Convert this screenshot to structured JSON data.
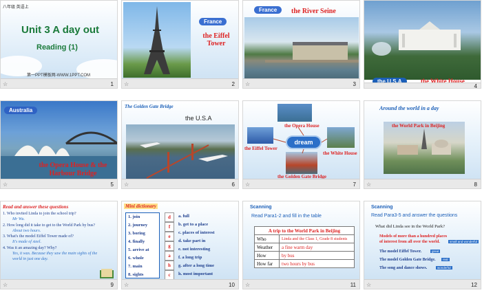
{
  "slides": [
    {
      "n": "1",
      "title": "Unit 3  A day out",
      "sub": "Reading  (1)",
      "small": "八年级 英语上",
      "wm": "第一PPT模板网-WWW.1PPT.COM"
    },
    {
      "n": "2",
      "pill": "France",
      "label": "the Eiffel Tower"
    },
    {
      "n": "3",
      "pill": "France",
      "label": "the River Seine"
    },
    {
      "n": "4",
      "pill": "the U.S.A",
      "label": "the White House"
    },
    {
      "n": "5",
      "pill": "Australia",
      "label": "the Opera House & the Harbour Bridge"
    },
    {
      "n": "6",
      "head": "The Golden Gate Bridge",
      "label": "the U.S.A"
    },
    {
      "n": "7",
      "center": "dream",
      "items": [
        "the Opera House",
        "the Eiffel Tower",
        "the White House",
        "the Golden Gate Bridge"
      ]
    },
    {
      "n": "8",
      "head": "Around the world in a day",
      "label": "the World Park in Beijing"
    },
    {
      "n": "9",
      "head": "Read and answer these questions",
      "lines": [
        "1. Who invited Linda to join the school trip?",
        "Mr Wu.",
        "2. How long did it take to get to the World Park by bus?",
        "About two hours.",
        "3. What's the model Eiffel Tower made of?",
        "It's made of steel.",
        "4. Was it an amazing day? Why?",
        "Yes, it was.  Because they saw the main sights of the world in just one day."
      ]
    },
    {
      "n": "10",
      "head": "Mini dictionary",
      "left": [
        "1. join",
        "2. journey",
        "3. boring",
        "4. finally",
        "5. arrive at",
        "6. whole",
        "7. main",
        "8. sights"
      ],
      "letters": [
        "d",
        "f",
        "e",
        "g",
        "a",
        "h",
        "c",
        "b"
      ],
      "right": [
        "a. full",
        "b. get to a place",
        "c. places of interest",
        "d. take part in",
        "e. not interesting",
        "f. a long trip",
        "g. after a long time",
        "h. most important"
      ]
    },
    {
      "n": "11",
      "head": "Scanning",
      "instr": "Read  Para1-2  and  fill in the table",
      "ttl": "A  trip to the World Park in Beijing",
      "rows": [
        [
          "Who",
          "Linda and the Class 1, Grade 8 students"
        ],
        [
          "Weather",
          "a fine warm day"
        ],
        [
          "How",
          "by bus"
        ],
        [
          "How far",
          "two  hours  by bus"
        ]
      ]
    },
    {
      "n": "12",
      "head": "Scanning",
      "instr": "Read  Para3-5  and  answer  the questions",
      "q": "What did Linda see in the World Park?",
      "a": [
        "Models of more than a hundred places of interest from all over the world.",
        "The model Eiffel Tower.",
        "The model Golden Gate Bridge.",
        "The song and dance shows."
      ],
      "tags": [
        "small and wonderful",
        "great",
        "real",
        "wonderful"
      ]
    }
  ],
  "colors": {
    "green": "#1a7a3a",
    "red": "#d22222",
    "blue": "#3a6fd1",
    "navy": "#1b3c8c"
  }
}
